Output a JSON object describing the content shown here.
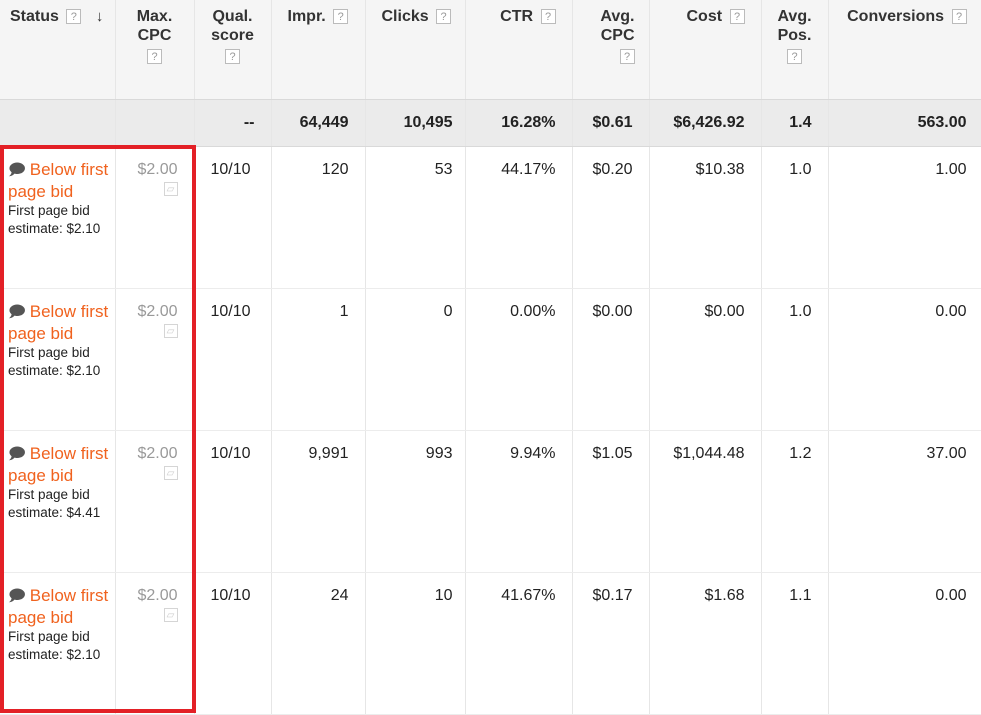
{
  "columns": [
    {
      "key": "status",
      "label": "Status",
      "help": "?"
    },
    {
      "key": "max_cpc",
      "label": "Max. CPC",
      "help": "?"
    },
    {
      "key": "qual",
      "label": "Qual. score",
      "help": "?"
    },
    {
      "key": "impr",
      "label": "Impr.",
      "help": "?"
    },
    {
      "key": "clicks",
      "label": "Clicks",
      "help": "?"
    },
    {
      "key": "ctr",
      "label": "CTR",
      "help": "?"
    },
    {
      "key": "avg_cpc",
      "label": "Avg. CPC",
      "help": "?"
    },
    {
      "key": "cost",
      "label": "Cost",
      "help": "?"
    },
    {
      "key": "avg_pos",
      "label": "Avg. Pos.",
      "help": "?"
    },
    {
      "key": "conversions",
      "label": "Conversions",
      "help": "?"
    }
  ],
  "header_lines": {
    "max_cpc": [
      "Max.",
      "CPC"
    ],
    "qual": [
      "Qual.",
      "score"
    ],
    "avg_cpc": [
      "Avg.",
      "CPC"
    ],
    "avg_pos": [
      "Avg.",
      "Pos."
    ]
  },
  "sort_indicator": "↓",
  "totals": {
    "status": "",
    "max_cpc": "",
    "qual": "--",
    "impr": "64,449",
    "clicks": "10,495",
    "ctr": "16.28%",
    "avg_cpc": "$0.61",
    "cost": "$6,426.92",
    "avg_pos": "1.4",
    "conversions": "563.00"
  },
  "rows": [
    {
      "status": "Below first page bid",
      "status_note": "First page bid estimate: $2.10",
      "max_cpc": "$2.00",
      "qual": "10/10",
      "impr": "120",
      "clicks": "53",
      "ctr": "44.17%",
      "avg_cpc": "$0.20",
      "cost": "$10.38",
      "avg_pos": "1.0",
      "conversions": "1.00"
    },
    {
      "status": "Below first page bid",
      "status_note": "First page bid estimate: $2.10",
      "max_cpc": "$2.00",
      "qual": "10/10",
      "impr": "1",
      "clicks": "0",
      "ctr": "0.00%",
      "avg_cpc": "$0.00",
      "cost": "$0.00",
      "avg_pos": "1.0",
      "conversions": "0.00"
    },
    {
      "status": "Below first page bid",
      "status_note": "First page bid estimate: $4.41",
      "max_cpc": "$2.00",
      "qual": "10/10",
      "impr": "9,991",
      "clicks": "993",
      "ctr": "9.94%",
      "avg_cpc": "$1.05",
      "cost": "$1,044.48",
      "avg_pos": "1.2",
      "conversions": "37.00"
    },
    {
      "status": "Below first page bid",
      "status_note": "First page bid estimate: $2.10",
      "max_cpc": "$2.00",
      "qual": "10/10",
      "impr": "24",
      "clicks": "10",
      "ctr": "41.67%",
      "avg_cpc": "$0.17",
      "cost": "$1.68",
      "avg_pos": "1.1",
      "conversions": "0.00"
    }
  ],
  "icons": {
    "status_bubble": "speech-bubble-icon",
    "graph": "chart-icon",
    "help": "help-icon"
  },
  "colors": {
    "status_link": "#f0621e",
    "highlight_border": "#e32026",
    "header_bg": "#f5f5f5",
    "totals_bg": "#ebebeb"
  }
}
